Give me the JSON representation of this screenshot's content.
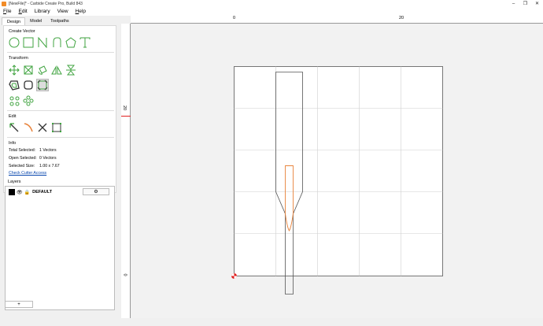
{
  "window": {
    "title": "[NewFile]* - Carbide Create Pro, Build 843",
    "controls": {
      "minimize": "–",
      "restore": "❐",
      "close": "✕"
    }
  },
  "menu": {
    "file": {
      "key": "F",
      "rest": "ile"
    },
    "edit": {
      "key": "E",
      "rest": "dit"
    },
    "library": "Library",
    "view": "View",
    "help": {
      "key": "H",
      "rest": "elp"
    }
  },
  "tabs": [
    "Design",
    "Model",
    "Toolpaths"
  ],
  "sections": {
    "create_vector": "Create Vector",
    "transform": "Transform",
    "edit": "Edit",
    "info": "Info",
    "layers": "Layers"
  },
  "info": {
    "total_selected_label": "Total Selected:",
    "total_selected_value": "1 Vectors",
    "open_selected_label": "Open Selected:",
    "open_selected_value": "0 Vectors",
    "selected_size_label": "Selected Size:",
    "selected_size_value": "1.00 x 7.67",
    "check_cutter_link": "Check Cutter Access"
  },
  "layers": {
    "items": [
      {
        "name": "DEFAULT",
        "color": "#000000"
      }
    ],
    "add_button": "+",
    "gear_icon": "⚙"
  },
  "rulers": {
    "top": [
      "0",
      "20"
    ],
    "left": [
      "20",
      "0"
    ]
  },
  "colors": {
    "accent_green": "#3fa33f",
    "selected_vector": "#e8823a",
    "vector": "#555555",
    "origin_red": "#e02020"
  }
}
